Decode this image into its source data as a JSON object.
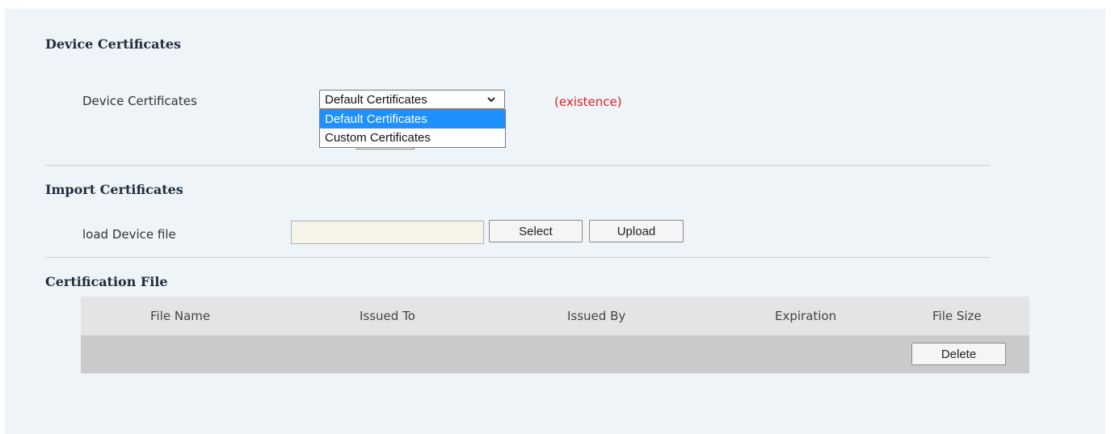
{
  "device_certificates": {
    "section_title": "Device Certificates",
    "label": "Device Certificates",
    "select_value": "Default Certificates",
    "options": [
      "Default Certificates",
      "Custom Certificates"
    ],
    "active_option_index": 0,
    "status": "(existence)",
    "status_color": "#e02020"
  },
  "import_certificates": {
    "section_title": "Import Certificates",
    "label": "load Device file",
    "file_value": "",
    "select_button": "Select",
    "upload_button": "Upload"
  },
  "certification_file": {
    "section_title": "Certification File",
    "columns": [
      "File Name",
      "Issued To",
      "Issued By",
      "Expiration",
      "File Size"
    ],
    "rows": [
      {
        "file_name": "",
        "issued_to": "",
        "issued_by": "",
        "expiration": "",
        "file_size": "",
        "delete_button": "Delete"
      }
    ]
  },
  "colors": {
    "panel_bg": "#eef4f7",
    "highlight": "#1e90ff",
    "header_bg": "#e2e4e6",
    "row_bg": "#cacaca"
  },
  "icons": {
    "select_chevron": "chevron-down-icon"
  }
}
